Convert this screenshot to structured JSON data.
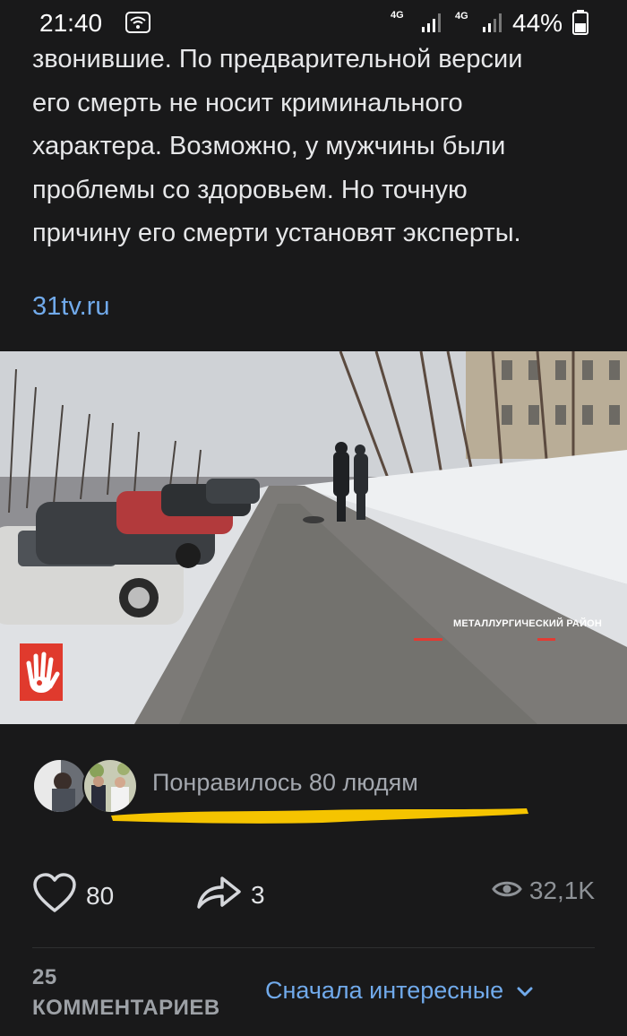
{
  "status_bar": {
    "time": "21:40",
    "network1": "4G",
    "network2": "4G",
    "battery": "44%"
  },
  "post": {
    "lines": [
      "звонившие. По предварительной версии",
      "его смерть не носит криминального",
      "характера. Возможно, у мужчины были",
      "проблемы со здоровьем. Но точную",
      "причину его смерти установят эксперты."
    ],
    "source_link": "31tv.ru",
    "video_overlay_label": "МЕТАЛЛУРГИЧЕСКИЙ РАЙОН"
  },
  "likes": {
    "liked_by_text": "Понравилось 80 людям",
    "highlight_color": "#f5c400"
  },
  "actions": {
    "like_count": "80",
    "share_count": "3",
    "views": "32,1K"
  },
  "comments": {
    "count_label": "25 КОММЕНТАРИЕВ",
    "sort_label": "Сначала интересные"
  },
  "colors": {
    "background": "#19191a",
    "link": "#71aaeb",
    "text": "#e1e3e6",
    "muted": "#8e9297"
  }
}
